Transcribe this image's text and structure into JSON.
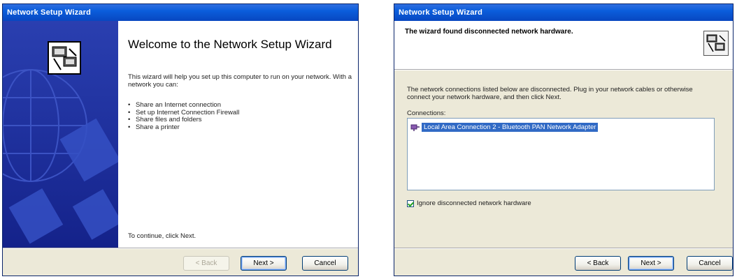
{
  "welcome": {
    "title": "Network Setup Wizard",
    "heading": "Welcome to the Network Setup Wizard",
    "intro": "This wizard will help you set up this computer to run on your network. With a network you can:",
    "bullets": [
      "Share an Internet connection",
      "Set up Internet Connection Firewall",
      "Share files and folders",
      "Share a printer"
    ],
    "continue": "To continue, click Next.",
    "buttons": {
      "back": "< Back",
      "next": "Next >",
      "cancel": "Cancel"
    }
  },
  "hardware": {
    "title": "Network Setup Wizard",
    "heading": "The wizard found disconnected network hardware.",
    "instructions": "The network connections listed below are disconnected. Plug in your network cables or otherwise connect your network hardware, and then click Next.",
    "connections_label": "Connections:",
    "connections": [
      "Local Area Connection 2 - Bluetooth PAN Network Adapter"
    ],
    "ignore_label": "Ignore disconnected network hardware",
    "ignore_checked": true,
    "buttons": {
      "back": "< Back",
      "next": "Next >",
      "cancel": "Cancel"
    }
  },
  "colors": {
    "titlebar": "#0a5ddc",
    "side_panel": "#1d2f9e",
    "dialog_face": "#ece9d8",
    "selection": "#316ac5"
  },
  "icons": [
    "network-computers-icon",
    "network-adapter-icon",
    "checkbox-checked-icon"
  ]
}
